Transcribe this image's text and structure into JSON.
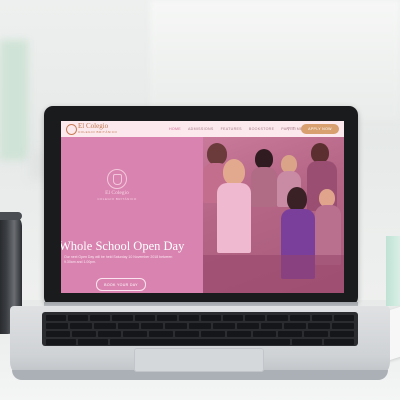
{
  "website": {
    "logo": {
      "name": "El Colegio",
      "tagline": "COLEGIO BRITÁNICO"
    },
    "nav": [
      "HOME",
      "ADMISSIONS",
      "FEATURES",
      "BOOKSTORE",
      "PART TIMES"
    ],
    "cta_label": "APPLY NOW",
    "crest": {
      "name": "El Colegio",
      "tagline": "COLEGIO BRITÁNICO"
    },
    "hero": {
      "title": "Whole School Open Day",
      "description": "Our next Open Day will be held Saturday 10 November 2018 between 9.30am and 1.00pm.",
      "button_label": "BOOK YOUR DAY"
    }
  },
  "colors": {
    "hero_pink": "#d984b0",
    "nav_bg": "#fbe9ee",
    "cta_gold": "#d8a06f",
    "laptop_bezel": "#1a1b1d"
  }
}
